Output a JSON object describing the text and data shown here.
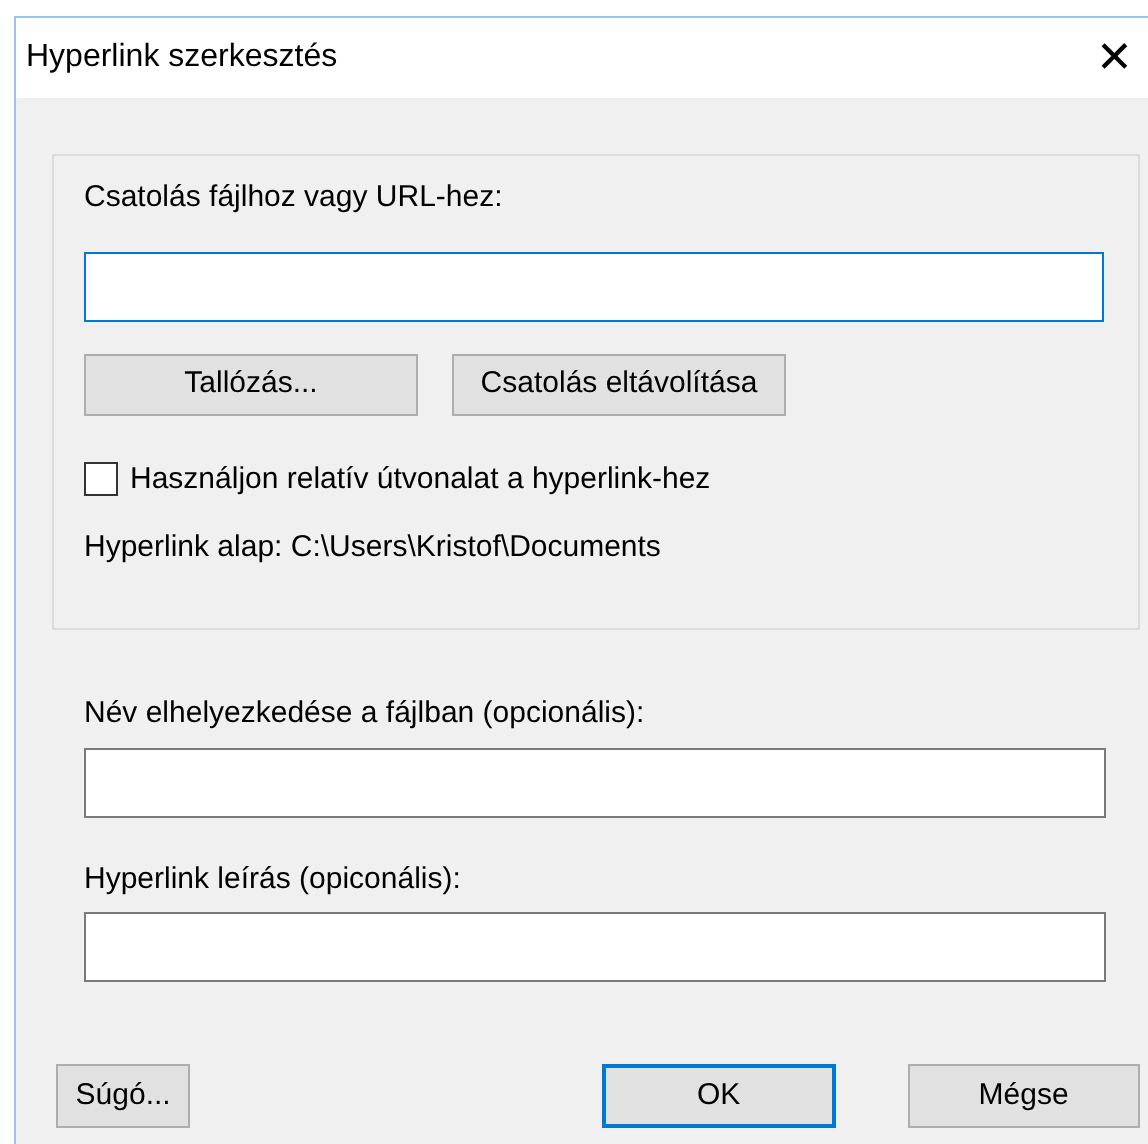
{
  "window": {
    "title": "Hyperlink szerkesztés",
    "close": "✕"
  },
  "link_group": {
    "label": "Csatolás fájlhoz vagy URL-hez:",
    "field": {
      "focused": true
    },
    "buttons": [
      {
        "label": "Tallózás..."
      },
      {
        "label": "Csatolás eltávolítása"
      }
    ],
    "checkbox": {
      "label": "Használjon relatív útvonalat a hyperlink-hez",
      "checked": false
    },
    "base": "Hyperlink alap: C:\\Users\\Kristof\\Documents"
  },
  "fields": [
    {
      "label": "Név elhelyezkedése a fájlban (opcionális):",
      "focused": false
    },
    {
      "label": "Hyperlink leírás (opiconális):",
      "focused": false
    }
  ],
  "buttons": [
    {
      "label": "Súgó...",
      "default": false
    },
    {
      "label": "OK",
      "default": true
    },
    {
      "label": "Mégse",
      "default": false
    }
  ]
}
